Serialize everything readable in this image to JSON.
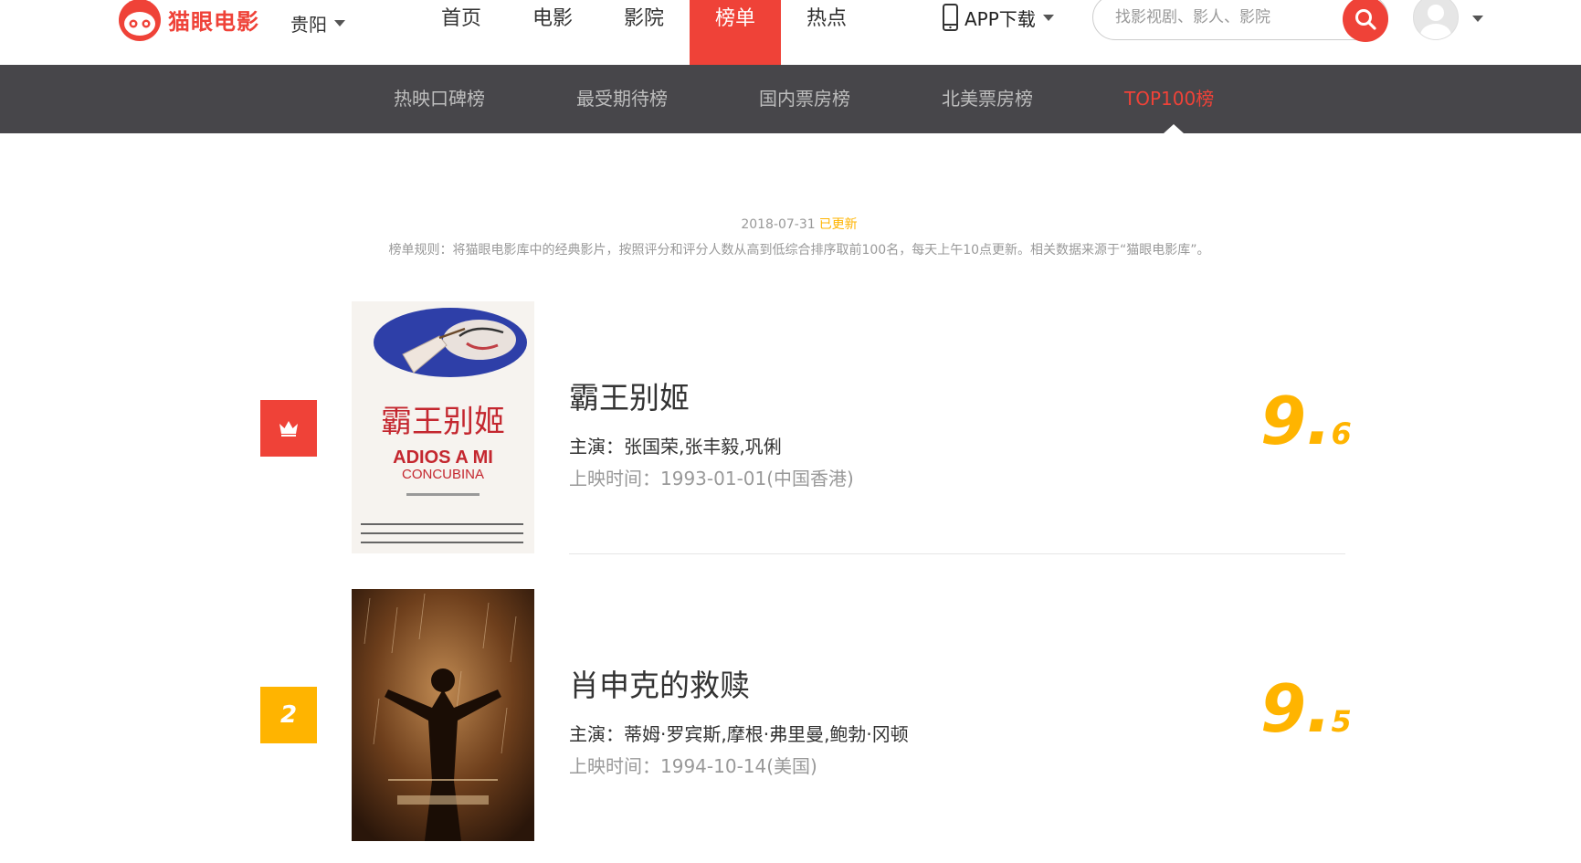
{
  "header": {
    "logo_text": "猫眼电影",
    "city": "贵阳",
    "nav": [
      "首页",
      "电影",
      "影院",
      "榜单",
      "热点"
    ],
    "active_nav": "榜单",
    "app_download": "APP下载",
    "search_placeholder": "找影视剧、影人、影院"
  },
  "subnav": {
    "items": [
      "热映口碑榜",
      "最受期待榜",
      "国内票房榜",
      "北美票房榜",
      "TOP100榜"
    ],
    "active": "TOP100榜"
  },
  "update": {
    "date": "2018-07-31",
    "status": "已更新",
    "rule": "榜单规则：将猫眼电影库中的经典影片，按照评分和评分人数从高到低综合排序取前100名，每天上午10点更新。相关数据来源于“猫眼电影库”。"
  },
  "movies": [
    {
      "rank": "1",
      "rank_icon": "crown-icon",
      "name": "霸王别姬",
      "stars": "主演：张国荣,张丰毅,巩俐",
      "release": "上映时间：1993-01-01(中国香港)",
      "score_int": "9.",
      "score_frac": "6",
      "poster": {
        "title": "霸王别姬",
        "subtitle_1": "ADIOS A MI",
        "subtitle_2": "CONCUBINA"
      }
    },
    {
      "rank": "2",
      "name": "肖申克的救赎",
      "stars": "主演：蒂姆·罗宾斯,摩根·弗里曼,鲍勃·冈顿",
      "release": "上映时间：1994-10-14(美国)",
      "score_int": "9.",
      "score_frac": "5",
      "poster": {}
    }
  ],
  "colors": {
    "brand_red": "#ef4238",
    "score_gold": "#ffb400",
    "subnav_bg": "#47464a"
  }
}
